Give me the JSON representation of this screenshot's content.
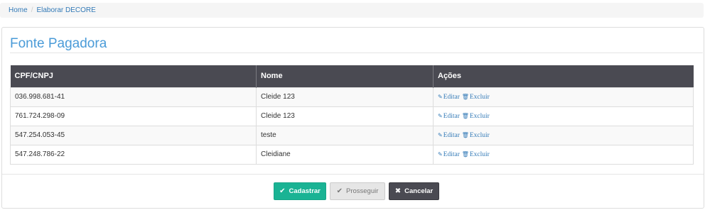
{
  "breadcrumb": {
    "home": "Home",
    "separator": "/",
    "current": "Elaborar DECORE"
  },
  "panel": {
    "title": "Fonte Pagadora"
  },
  "table": {
    "headers": [
      "CPF/CNPJ",
      "Nome",
      "Ações"
    ],
    "rows": [
      {
        "cpf": "036.998.681-41",
        "nome": "Cleide 123"
      },
      {
        "cpf": "761.724.298-09",
        "nome": "Cleide 123"
      },
      {
        "cpf": "547.254.053-45",
        "nome": "teste"
      },
      {
        "cpf": "547.248.786-22",
        "nome": "Cleidiane"
      }
    ],
    "actions": {
      "edit_label": "Editar",
      "delete_label": "Excluir",
      "edit_icon": "edit-icon",
      "delete_icon": "trash-icon"
    }
  },
  "buttons": {
    "cadastrar": "Cadastrar",
    "prosseguir": "Prosseguir",
    "cancelar": "Cancelar"
  },
  "colors": {
    "accent": "#1ab394",
    "title": "#4a9bd8",
    "header": "#4a4a52",
    "link": "#337ab7"
  }
}
